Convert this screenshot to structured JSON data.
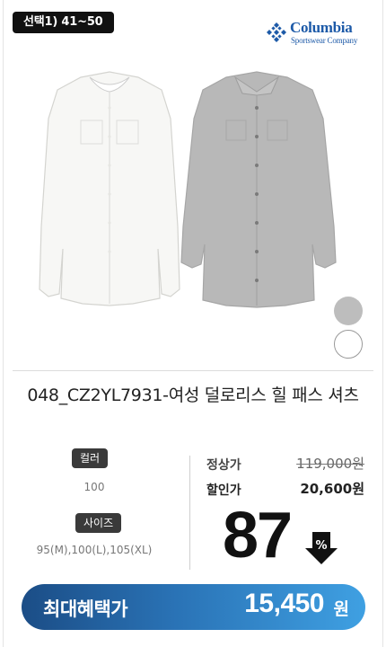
{
  "selection_badge": "선택1) 41~50",
  "brand": {
    "name": "Columbia",
    "sub": "Sportswear Company",
    "color": "#1d5aa8"
  },
  "product": {
    "title": "048_CZ2YL7931-여성 덜로리스 힐 패스 셔츠",
    "image_icon": "shirt-image",
    "swatches": [
      {
        "name": "gray",
        "color": "#bdbdbd"
      },
      {
        "name": "white",
        "color": "#ffffff"
      }
    ]
  },
  "options": {
    "color_label": "컬러",
    "color_value": "100",
    "size_label": "사이즈",
    "size_value": "95(M),100(L),105(XL)"
  },
  "price": {
    "regular_label": "정상가",
    "regular_value": "119,000원",
    "sale_label": "할인가",
    "sale_value": "20,600원",
    "discount_percent": "87",
    "discount_icon": "down-arrow-percent-icon"
  },
  "best_price": {
    "label": "최대혜택가",
    "value": "15,450",
    "unit": "원"
  },
  "colors": {
    "accent_start": "#1b4d86",
    "accent_end": "#3fa0e2"
  }
}
